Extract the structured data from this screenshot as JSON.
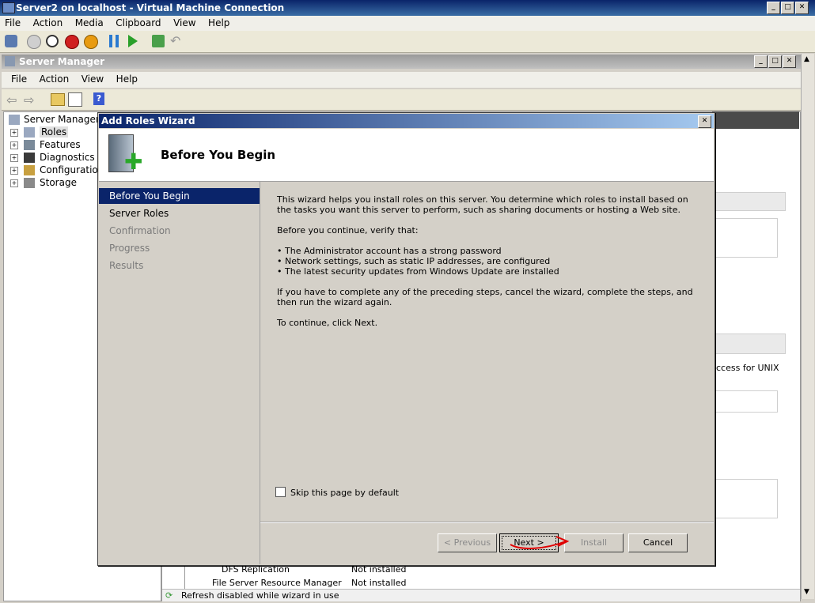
{
  "vm_window": {
    "title": "Server2 on localhost - Virtual Machine Connection",
    "menu": [
      "File",
      "Action",
      "Media",
      "Clipboard",
      "View",
      "Help"
    ],
    "toolbar_icons": [
      "ctrl-alt-del-icon",
      "start-icon",
      "turn-off-icon",
      "shutdown-icon",
      "power-icon",
      "pause-icon",
      "resume-icon",
      "snapshot-icon",
      "revert-icon"
    ]
  },
  "server_manager": {
    "title": "Server Manager",
    "menu": [
      "File",
      "Action",
      "View",
      "Help"
    ],
    "tree": {
      "root": "Server Manager (SE",
      "items": [
        "Roles",
        "Features",
        "Diagnostics",
        "Configuration",
        "Storage"
      ]
    },
    "background": {
      "right_text": "ccess for UNIX",
      "table_rows": [
        {
          "name": "DFS Replication",
          "status": "Not installed"
        },
        {
          "name": "File Server Resource Manager",
          "status": "Not installed"
        }
      ],
      "status_bar": "Refresh disabled while wizard in use"
    }
  },
  "wizard": {
    "title": "Add Roles Wizard",
    "heading": "Before You Begin",
    "nav": [
      {
        "label": "Before You Begin",
        "state": "active"
      },
      {
        "label": "Server Roles",
        "state": "enabled"
      },
      {
        "label": "Confirmation",
        "state": "disabled"
      },
      {
        "label": "Progress",
        "state": "disabled"
      },
      {
        "label": "Results",
        "state": "disabled"
      }
    ],
    "body": {
      "intro": "This wizard helps you install roles on this server. You determine which roles to install based on the tasks you want this server to perform, such as sharing documents or hosting a Web site.",
      "verify_heading": "Before you continue, verify that:",
      "bullets": [
        "The Administrator account has a strong password",
        "Network settings, such as static IP addresses, are configured",
        "The latest security updates from Windows Update are installed"
      ],
      "note": "If you have to complete any of the preceding steps, cancel the wizard, complete the steps, and then run the wizard again.",
      "continue": "To continue, click Next."
    },
    "skip_label": "Skip this page by default",
    "skip_checked": false,
    "buttons": {
      "previous": "< Previous",
      "next": "Next >",
      "install": "Install",
      "cancel": "Cancel"
    }
  },
  "colors": {
    "title_active": "#0a246a",
    "nav_active": "#0a246a",
    "dialog_bg": "#d4d0c8",
    "annotation": "#e00000"
  }
}
